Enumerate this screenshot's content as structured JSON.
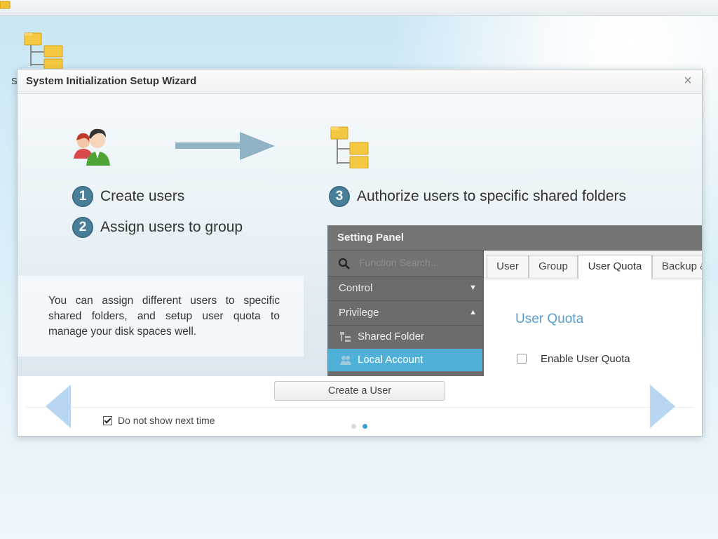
{
  "desktop": {
    "icon_label": "S"
  },
  "wizard": {
    "title": "System Initialization Setup Wizard",
    "close_symbol": "×",
    "steps": [
      {
        "number": "1",
        "text": "Create users"
      },
      {
        "number": "2",
        "text": "Assign users to group"
      },
      {
        "number": "3",
        "text": "Authorize users to specific shared folders"
      }
    ],
    "info_text": "You can assign different users to specific shared folders, and setup user quota to manage your disk spaces well.",
    "setting_panel": {
      "title": "Setting Panel",
      "search_placeholder": "Function Search...",
      "sidebar": [
        {
          "label": "Control",
          "caret": "▼"
        },
        {
          "label": "Privilege",
          "caret": "▲"
        }
      ],
      "subitems": [
        {
          "label": "Shared Folder",
          "active": false
        },
        {
          "label": "Local Account",
          "active": true
        }
      ],
      "tabs": [
        "User",
        "Group",
        "User Quota",
        "Backup &"
      ],
      "active_tab": "User Quota",
      "section_title": "User Quota",
      "checkbox_label": "Enable User Quota",
      "checkbox_checked": false
    },
    "create_button": "Create a User",
    "dont_show_label": "Do not show next time",
    "dont_show_checked": true,
    "pager": {
      "total": 2,
      "current": 2
    }
  },
  "colors": {
    "step_badge": "#4a7f9a",
    "active_item": "#4fb0d8",
    "quota_title": "#5b9bc9",
    "nav_arrow": "#b7d6f2",
    "pager_active": "#3aa3d6"
  },
  "icons": [
    "users-icon",
    "right-arrow-icon",
    "folder-tree-icon",
    "search-icon",
    "close-icon",
    "prev-arrow-icon",
    "next-arrow-icon"
  ]
}
